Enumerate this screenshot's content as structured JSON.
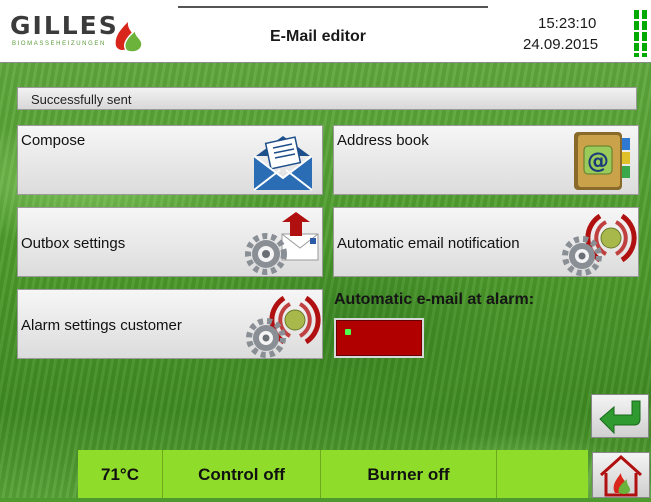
{
  "header": {
    "logo_text": "GILLES",
    "logo_sub": "BIOMASSEHEIZUNGEN",
    "title": "E-Mail editor",
    "time": "15:23:10",
    "date": "24.09.2015"
  },
  "status": {
    "text": "Successfully sent"
  },
  "tiles": {
    "compose": "Compose",
    "address_book": "Address book",
    "outbox_settings": "Outbox settings",
    "auto_notification": "Automatic email notification",
    "alarm_settings": "Alarm settings customer"
  },
  "alarm": {
    "label": "Automatic e-mail at alarm:",
    "state_color": "#b00000"
  },
  "bottom": {
    "temperature": "71°C",
    "control": "Control off",
    "burner": "Burner off"
  },
  "icons": [
    "gilles-flame-icon",
    "signal-icon",
    "envelope-icon",
    "address-book-icon",
    "gear-upload-icon",
    "gear-signal-icon",
    "back-arrow-icon",
    "home-flame-icon"
  ],
  "colors": {
    "accent_green": "#8fdc2a",
    "alarm_red": "#b00000"
  }
}
